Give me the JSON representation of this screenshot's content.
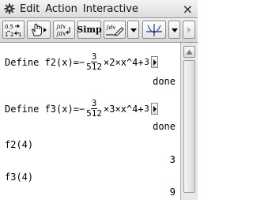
{
  "menubar": {
    "items": [
      "Edit",
      "Action",
      "Interactive"
    ],
    "close": "×"
  },
  "toolbar": {
    "simp_label": "Simp",
    "frac_top": "0.5",
    "frac_bottom": "1/2",
    "int_label": "∫dx"
  },
  "entries": [
    {
      "prefix": "Define f2(x)=−",
      "frac_num": "3",
      "frac_den": "512",
      "suffix": "×2×x^4+",
      "clip_num": "3",
      "result": "done"
    },
    {
      "prefix": "Define f3(x)=−",
      "frac_num": "3",
      "frac_den": "512",
      "suffix": "×3×x^4+",
      "clip_num": "3",
      "result": "done"
    },
    {
      "input": "f2(4)",
      "result": "3"
    },
    {
      "input": "f3(4)",
      "result": "9"
    }
  ]
}
